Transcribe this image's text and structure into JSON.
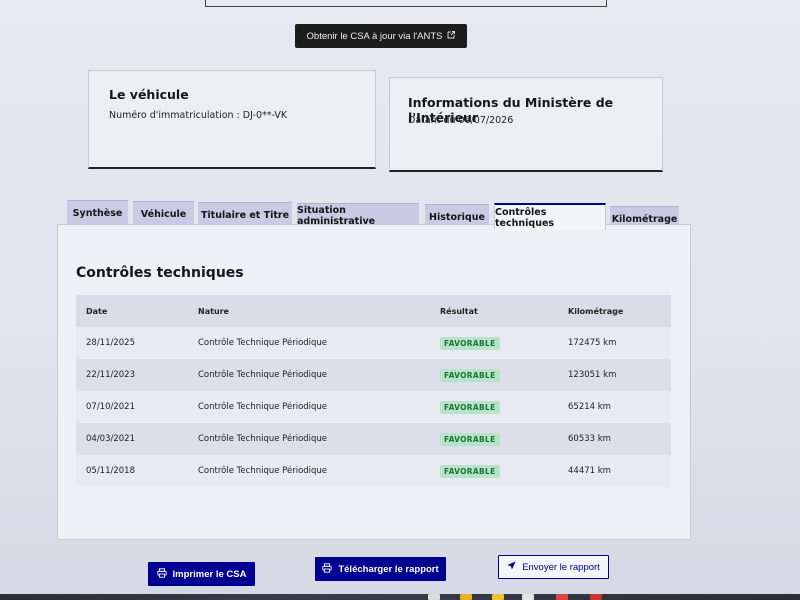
{
  "header": {
    "ants_button_label": "Obtenir le CSA à jour via l'ANTS",
    "ants_button_icon": "external-link-icon"
  },
  "vehicle_card": {
    "title": "Le véhicule",
    "registration": "Numéro d'immatriculation : DJ-0**-VK"
  },
  "ministry_card": {
    "title": "Informations du Ministère de l'Intérieur",
    "date": "Datant du 06/07/2026"
  },
  "tabs": [
    {
      "label": "Synthèse",
      "active": false
    },
    {
      "label": "Véhicule",
      "active": false
    },
    {
      "label": "Titulaire et Titre",
      "active": false
    },
    {
      "label": "Situation administrative",
      "active": false
    },
    {
      "label": "Historique",
      "active": false
    },
    {
      "label": "Contrôles techniques",
      "active": true
    },
    {
      "label": "Kilométrage",
      "active": false
    }
  ],
  "panel": {
    "title": "Contrôles techniques",
    "columns": [
      "Date",
      "Nature",
      "Résultat",
      "Kilométrage"
    ],
    "rows": [
      {
        "date": "28/11/2025",
        "nature": "Contrôle Technique Périodique",
        "result": "FAVORABLE",
        "km": "172475 km"
      },
      {
        "date": "22/11/2023",
        "nature": "Contrôle Technique Périodique",
        "result": "FAVORABLE",
        "km": "123051 km"
      },
      {
        "date": "07/10/2021",
        "nature": "Contrôle Technique Périodique",
        "result": "FAVORABLE",
        "km": "65214 km"
      },
      {
        "date": "04/03/2021",
        "nature": "Contrôle Technique Périodique",
        "result": "FAVORABLE",
        "km": "60533 km"
      },
      {
        "date": "05/11/2018",
        "nature": "Contrôle Technique Périodique",
        "result": "FAVORABLE",
        "km": "44471 km"
      }
    ]
  },
  "actions": {
    "print_label": "Imprimer le CSA",
    "download_label": "Télécharger le rapport",
    "send_label": "Envoyer le rapport"
  },
  "colors": {
    "primary": "#000091",
    "success_bg": "#b8e3c8",
    "success_text": "#18753c",
    "tab_inactive": "#c8cbe3"
  }
}
